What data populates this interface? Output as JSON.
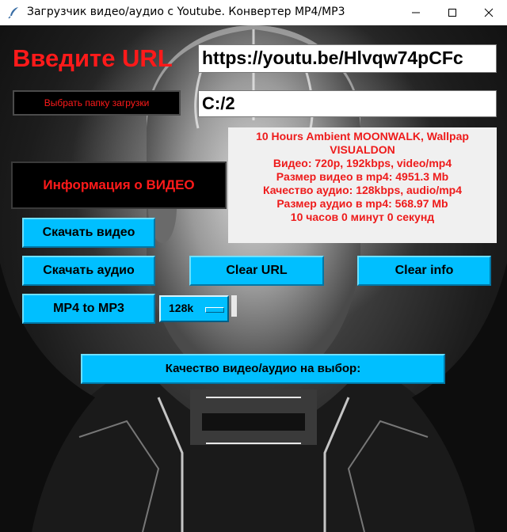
{
  "window": {
    "title": "Загрузчик видео/аудио с Youtube. Конвертер MP4/MP3",
    "controls": [
      "minimize-icon",
      "maximize-icon",
      "close-icon"
    ]
  },
  "form": {
    "url_label": "Введите URL",
    "url_value": "https://youtu.be/Hlvqw74pCFc",
    "folder_button": "Выбрать папку загрузки",
    "folder_value": "C:/2",
    "info_button": "Информация о ВИДЕО"
  },
  "info": {
    "lines": [
      "10 Hours Ambient MOONWALK, Wallpap",
      "VISUALDON",
      "Видео: 720p, 192kbps, video/mp4",
      "Размер видео в mp4:  4951.3 Mb",
      "Качество аудио: 128kbps, audio/mp4",
      "Размер аудио в mp4:  568.97 Mb",
      "10 часов 0 минут 0 секунд"
    ]
  },
  "buttons": {
    "download_video": "Скачать видео",
    "download_audio": "Скачать аудио",
    "clear_url": "Clear URL",
    "clear_info": "Clear info",
    "mp4_to_mp3": "MP4 to MP3",
    "quality_choice": "Качество видео/аудио на выбор:"
  },
  "bitrate": {
    "selected": "128k"
  },
  "colors": {
    "accent_blue": "#00bfff",
    "label_red": "#ff1a1a",
    "info_text_red": "#ee1b1b"
  }
}
